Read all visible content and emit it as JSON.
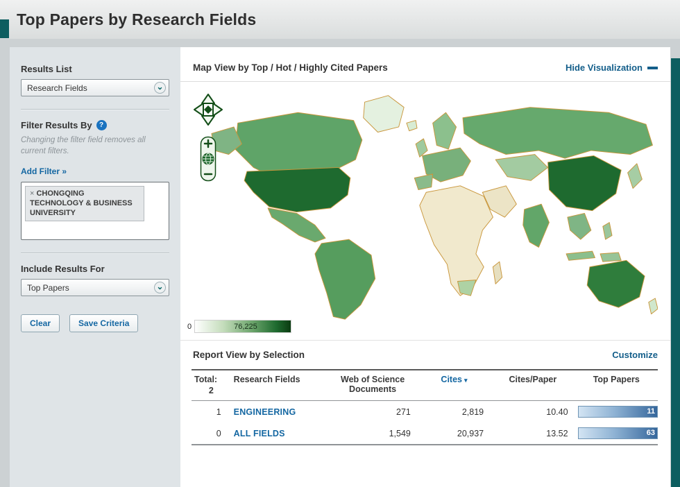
{
  "page": {
    "title": "Top Papers by Research Fields"
  },
  "icons": {
    "chevron_down": "⌄",
    "help": "?",
    "remove": "×",
    "sort_desc": "▾"
  },
  "colors": {
    "link_blue": "#1467a2",
    "accent_teal": "#0d5e60",
    "map_dark_green": "#1e6a2f",
    "map_border_orange": "#c9963b",
    "bar_blue": "#36679c"
  },
  "sidebar": {
    "results_list": {
      "label": "Results List",
      "selected": "Research Fields"
    },
    "filter": {
      "label": "Filter Results By",
      "note": "Changing the filter field removes all current filters.",
      "add_filter_label": "Add Filter »",
      "tag_label": "CHONGQING TECHNOLOGY & BUSINESS UNIVERSITY"
    },
    "include": {
      "label": "Include Results For",
      "selected": "Top Papers"
    },
    "buttons": {
      "clear": "Clear",
      "save": "Save Criteria"
    }
  },
  "main": {
    "map": {
      "title": "Map View by Top / Hot / Highly Cited Papers",
      "hide_label": "Hide Visualization",
      "legend": {
        "min": "0",
        "max": "76,225"
      }
    },
    "report": {
      "title": "Report View by Selection",
      "customize": "Customize",
      "table": {
        "total_label": "Total:",
        "total_value": "2",
        "col_field": "Research Fields",
        "col_docs": "Web of Science Documents",
        "col_cites": "Cites",
        "col_cpp": "Cites/Paper",
        "col_top": "Top Papers",
        "rows": [
          {
            "rank": "1",
            "field": "ENGINEERING",
            "docs": "271",
            "cites": "2,819",
            "cpp": "10.40",
            "top": "11"
          },
          {
            "rank": "0",
            "field": "ALL FIELDS",
            "docs": "1,549",
            "cites": "20,937",
            "cpp": "13.52",
            "top": "63"
          }
        ]
      }
    }
  }
}
